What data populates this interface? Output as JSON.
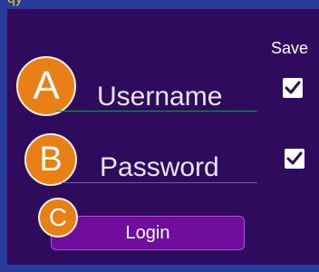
{
  "top_text": "qy",
  "save_label": "Save",
  "username": {
    "badge": "A",
    "label": "Username",
    "save_checked": true
  },
  "password": {
    "badge": "B",
    "label": "Password",
    "save_checked": true
  },
  "login": {
    "badge": "C",
    "label": "Login"
  },
  "colors": {
    "outer_background": "#283a9c",
    "panel_background": "#2e0b5c",
    "badge_fill": "#e88015",
    "button_fill": "#700c9e",
    "button_border": "#b050d8",
    "underline": "#2a8a6a",
    "top_text": "#f0c020"
  },
  "icons": {
    "checkbox_check": "check-icon"
  }
}
